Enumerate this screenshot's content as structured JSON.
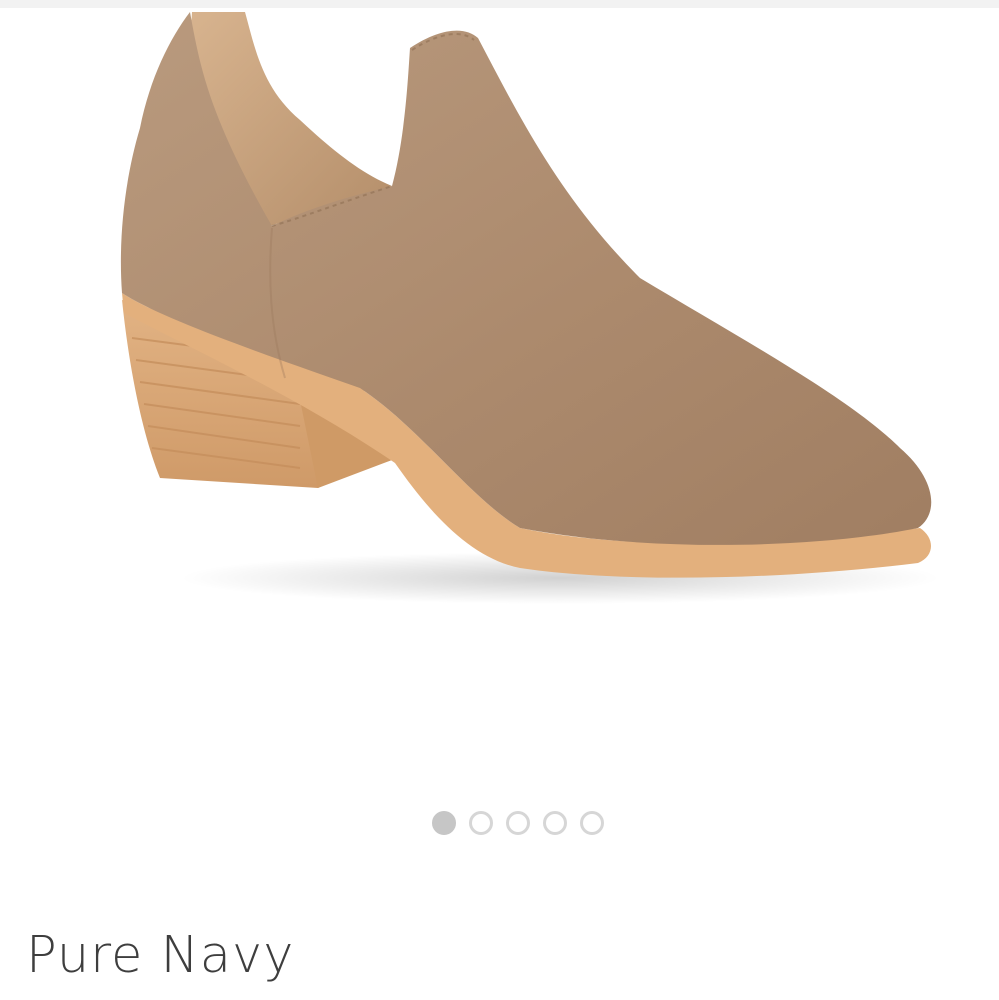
{
  "product": {
    "image_icon": "shoe-product-image",
    "brand": "Pure Navy"
  },
  "carousel": {
    "dot_count": 5,
    "active_index": 0
  },
  "colors": {
    "suede": "#b08e71",
    "sole": "#e0ae7c",
    "dot_active": "#c6c6c6",
    "dot_inactive": "#d6d6d6",
    "text": "#3e3e3e"
  }
}
